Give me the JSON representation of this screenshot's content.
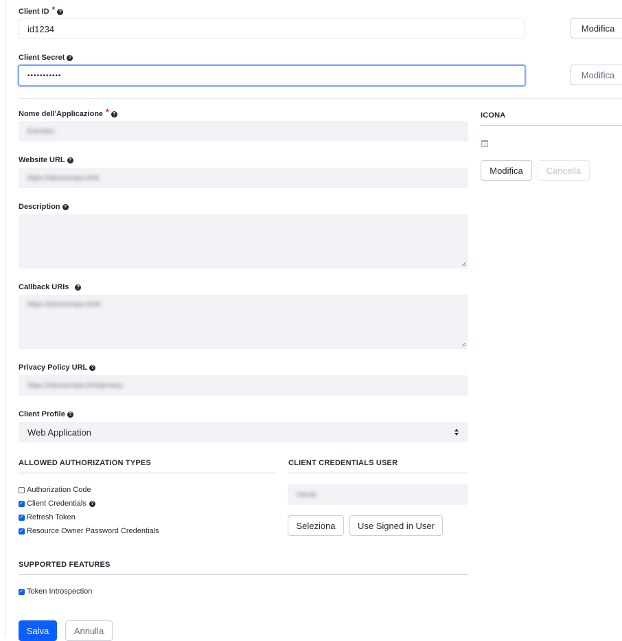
{
  "client_id": {
    "label": "Client ID",
    "value": "id1234",
    "edit_button": "Modifica"
  },
  "client_secret": {
    "label": "Client Secret",
    "value": "•••••••••••",
    "edit_button": "Modifica"
  },
  "app_name": {
    "label": "Nome dell'Applicazione",
    "value": "Esempio"
  },
  "website_url": {
    "label": "Website URL",
    "value": "https://sitoesempio.it/ok"
  },
  "description": {
    "label": "Description",
    "value": ""
  },
  "callback_uris": {
    "label": "Callback URIs",
    "value": "https://sitoesempio.it/ok/"
  },
  "privacy_url": {
    "label": "Privacy Policy URL",
    "value": "https://sitoesempio.it/ok/privacy"
  },
  "client_profile": {
    "label": "Client Profile",
    "value": "Web Application"
  },
  "icon_panel": {
    "title": "ICONA",
    "edit_button": "Modifica",
    "cancel_button": "Cancella"
  },
  "auth_types": {
    "title": "ALLOWED AUTHORIZATION TYPES",
    "items": [
      {
        "label": "Authorization Code",
        "checked": false
      },
      {
        "label": "Client Credentials",
        "checked": true
      },
      {
        "label": "Refresh Token",
        "checked": true
      },
      {
        "label": "Resource Owner Password Credentials",
        "checked": true
      }
    ]
  },
  "credentials_user": {
    "title": "CLIENT CREDENTIALS USER",
    "value": "Utente",
    "select_button": "Seleziona",
    "signed_in_button": "Use Signed in User"
  },
  "features": {
    "title": "SUPPORTED FEATURES",
    "items": [
      {
        "label": "Token Introspection",
        "checked": true
      }
    ]
  },
  "footer": {
    "save_button": "Salva",
    "cancel_button": "Annulla"
  },
  "colors": {
    "primary": "#0b5fff",
    "required": "#da1414",
    "field_bg": "#f1f2f5"
  }
}
